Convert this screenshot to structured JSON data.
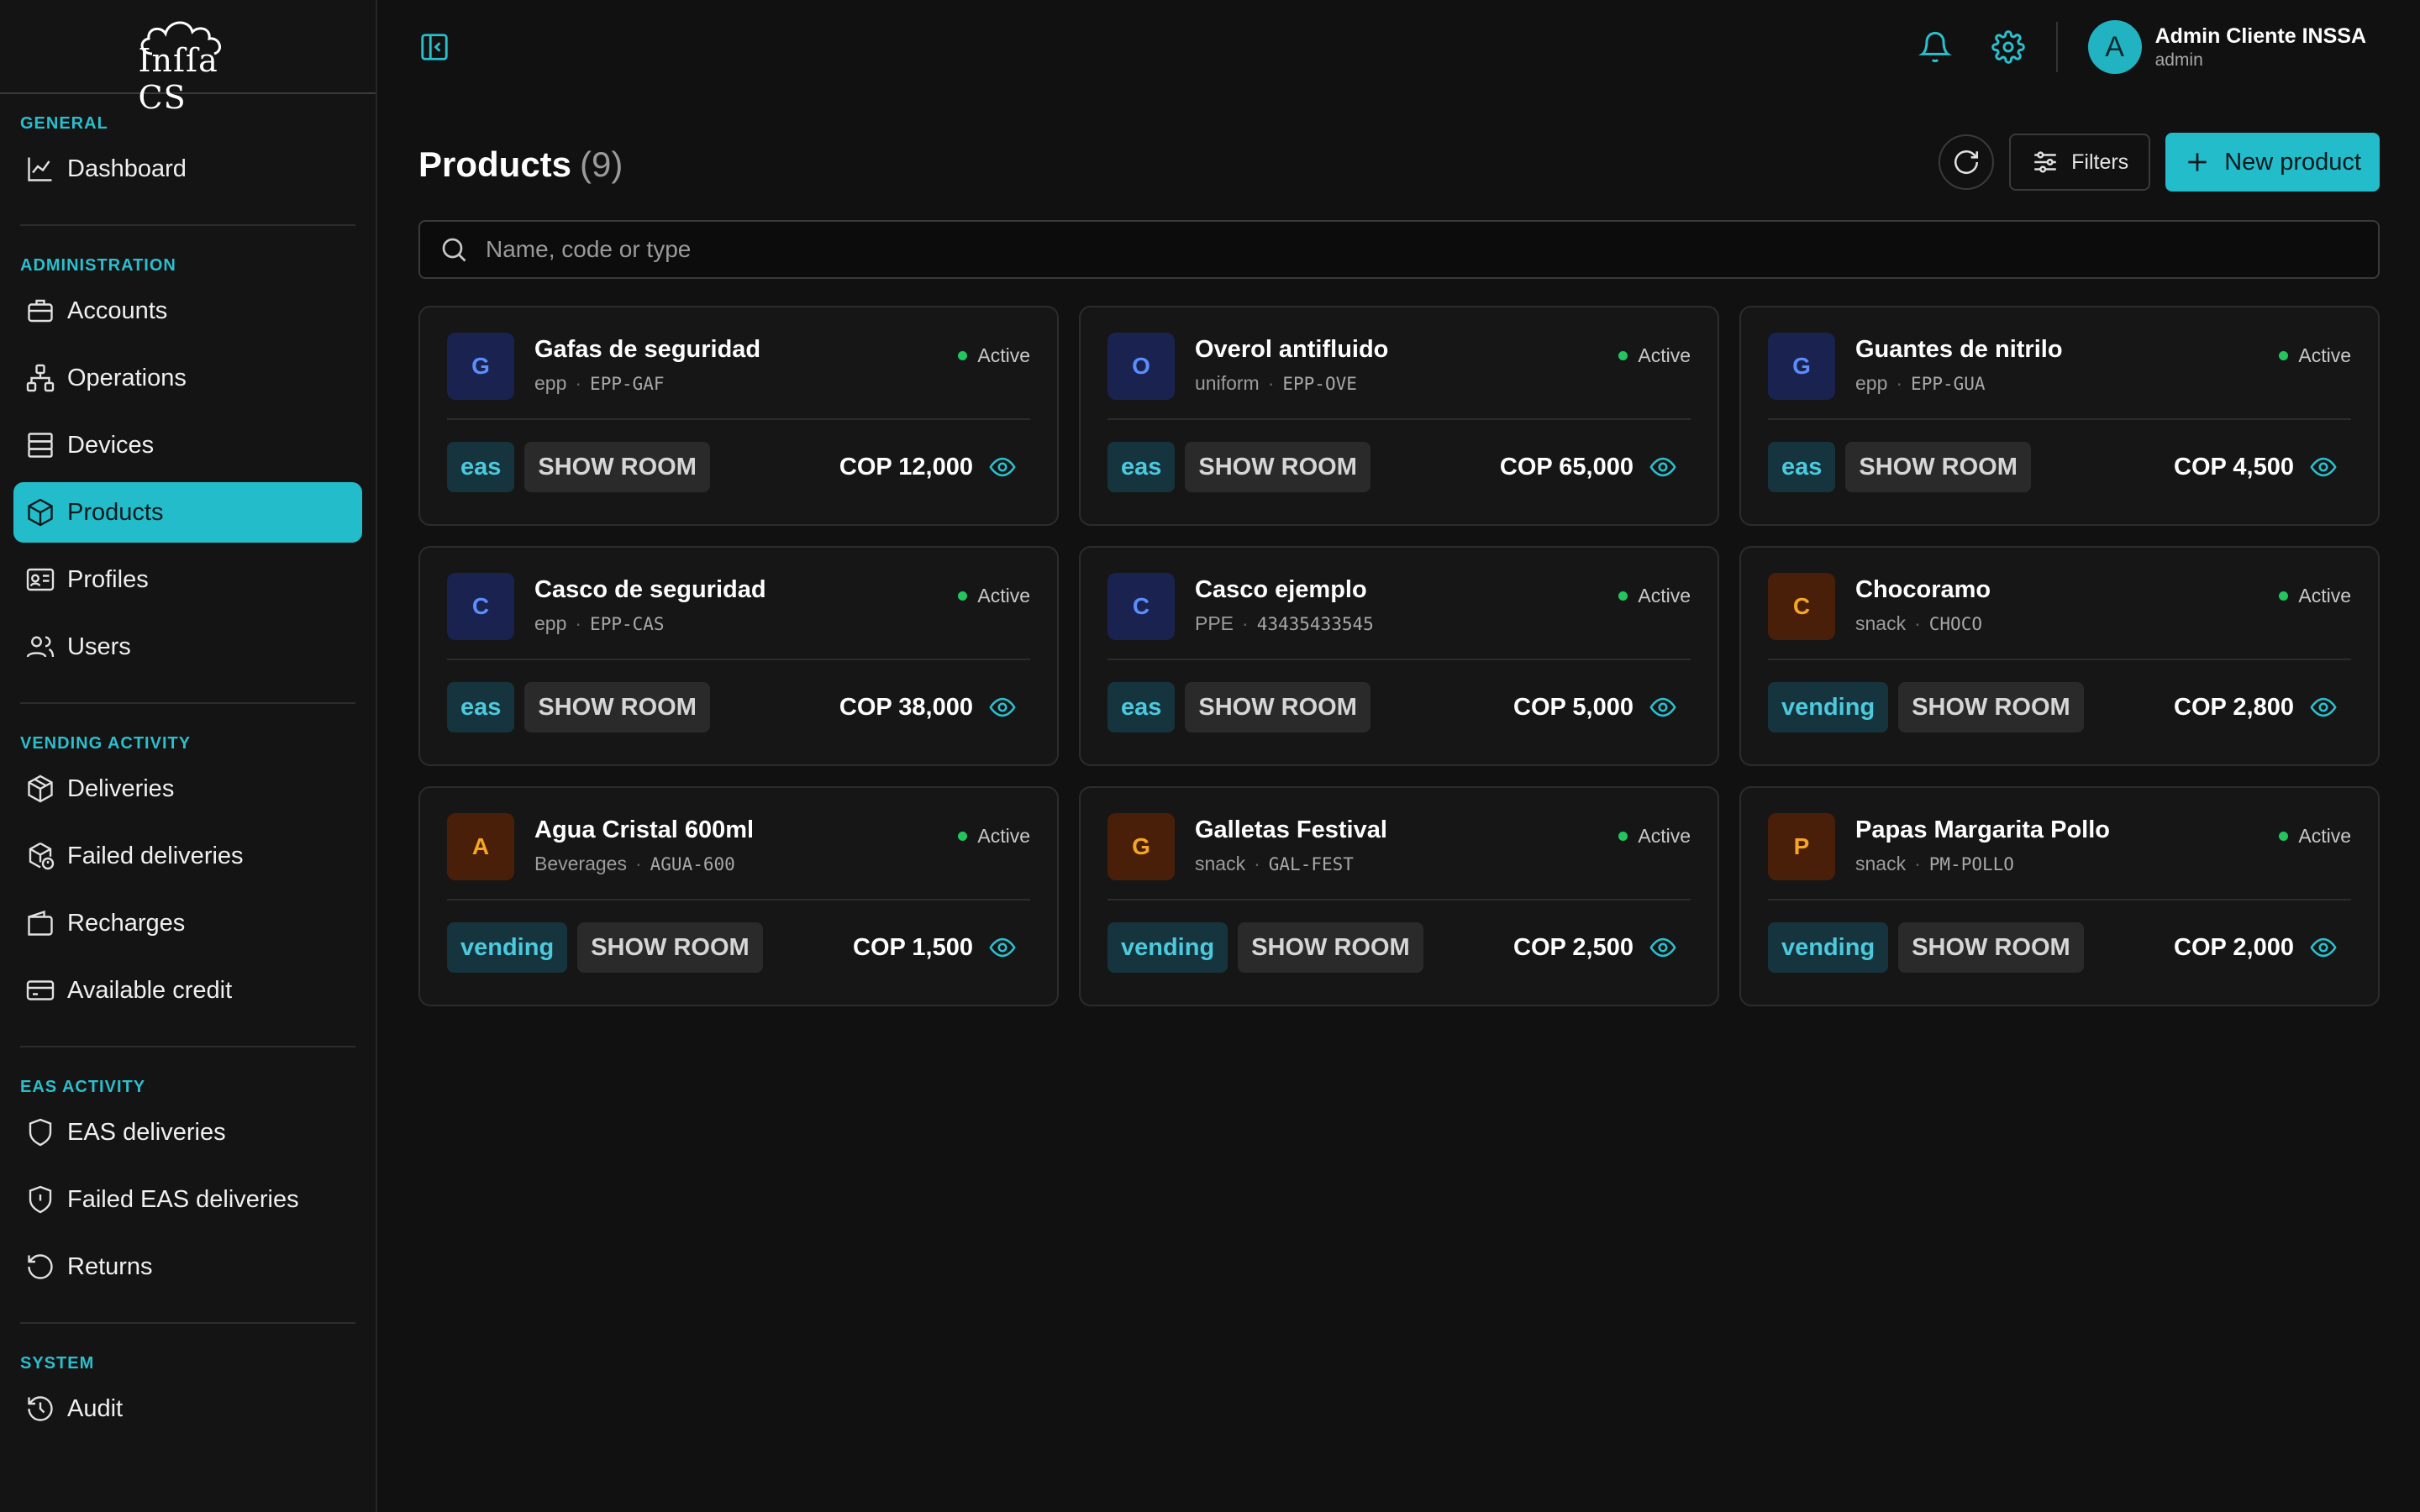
{
  "app": {
    "logo_text": "INSSA CS"
  },
  "sidebar": {
    "sections": [
      {
        "label": "GENERAL",
        "items": [
          {
            "label": "Dashboard",
            "icon": "chart-line-icon"
          }
        ]
      },
      {
        "label": "ADMINISTRATION",
        "items": [
          {
            "label": "Accounts",
            "icon": "briefcase-icon"
          },
          {
            "label": "Operations",
            "icon": "network-icon"
          },
          {
            "label": "Devices",
            "icon": "server-icon"
          },
          {
            "label": "Products",
            "icon": "box-icon",
            "active": true
          },
          {
            "label": "Profiles",
            "icon": "id-card-icon"
          },
          {
            "label": "Users",
            "icon": "users-icon"
          }
        ]
      },
      {
        "label": "VENDING ACTIVITY",
        "items": [
          {
            "label": "Deliveries",
            "icon": "package-icon"
          },
          {
            "label": "Failed deliveries",
            "icon": "package-alert-icon"
          },
          {
            "label": "Recharges",
            "icon": "wallet-icon"
          },
          {
            "label": "Available credit",
            "icon": "credit-card-icon"
          }
        ]
      },
      {
        "label": "EAS ACTIVITY",
        "items": [
          {
            "label": "EAS deliveries",
            "icon": "shield-icon"
          },
          {
            "label": "Failed EAS deliveries",
            "icon": "shield-alert-icon"
          },
          {
            "label": "Returns",
            "icon": "rotate-ccw-icon"
          }
        ]
      },
      {
        "label": "SYSTEM",
        "items": [
          {
            "label": "Audit",
            "icon": "history-icon"
          }
        ]
      }
    ]
  },
  "topbar": {
    "user": {
      "initial": "A",
      "name": "Admin Cliente INSSA",
      "role": "admin"
    }
  },
  "page": {
    "title": "Products",
    "count": "(9)",
    "filters_label": "Filters",
    "new_label": "New product",
    "search_placeholder": "Name, code or type"
  },
  "products": [
    {
      "initial": "G",
      "color": "blue",
      "name": "Gafas de seguridad",
      "type": "epp",
      "code": "EPP-GAF",
      "status": "Active",
      "tag": "eas",
      "room": "SHOW ROOM",
      "price": "COP 12,000"
    },
    {
      "initial": "O",
      "color": "blue",
      "name": "Overol antifluido",
      "type": "uniform",
      "code": "EPP-OVE",
      "status": "Active",
      "tag": "eas",
      "room": "SHOW ROOM",
      "price": "COP 65,000"
    },
    {
      "initial": "G",
      "color": "blue",
      "name": "Guantes de nitrilo",
      "type": "epp",
      "code": "EPP-GUA",
      "status": "Active",
      "tag": "eas",
      "room": "SHOW ROOM",
      "price": "COP 4,500"
    },
    {
      "initial": "C",
      "color": "blue",
      "name": "Casco de seguridad",
      "type": "epp",
      "code": "EPP-CAS",
      "status": "Active",
      "tag": "eas",
      "room": "SHOW ROOM",
      "price": "COP 38,000"
    },
    {
      "initial": "C",
      "color": "blue",
      "name": "Casco ejemplo",
      "type": "PPE",
      "code": "43435433545",
      "status": "Active",
      "tag": "eas",
      "room": "SHOW ROOM",
      "price": "COP 5,000"
    },
    {
      "initial": "C",
      "color": "brown",
      "name": "Chocoramo",
      "type": "snack",
      "code": "CHOCO",
      "status": "Active",
      "tag": "vending",
      "room": "SHOW ROOM",
      "price": "COP 2,800"
    },
    {
      "initial": "A",
      "color": "brown",
      "name": "Agua Cristal 600ml",
      "type": "Beverages",
      "code": "AGUA-600",
      "status": "Active",
      "tag": "vending",
      "room": "SHOW ROOM",
      "price": "COP 1,500"
    },
    {
      "initial": "G",
      "color": "brown",
      "name": "Galletas Festival",
      "type": "snack",
      "code": "GAL-FEST",
      "status": "Active",
      "tag": "vending",
      "room": "SHOW ROOM",
      "price": "COP 2,500"
    },
    {
      "initial": "P",
      "color": "brown",
      "name": "Papas Margarita Pollo",
      "type": "snack",
      "code": "PM-POLLO",
      "status": "Active",
      "tag": "vending",
      "room": "SHOW ROOM",
      "price": "COP 2,000"
    }
  ],
  "colors": {
    "accent": "#22bccb",
    "active_dot": "#22c55e"
  }
}
